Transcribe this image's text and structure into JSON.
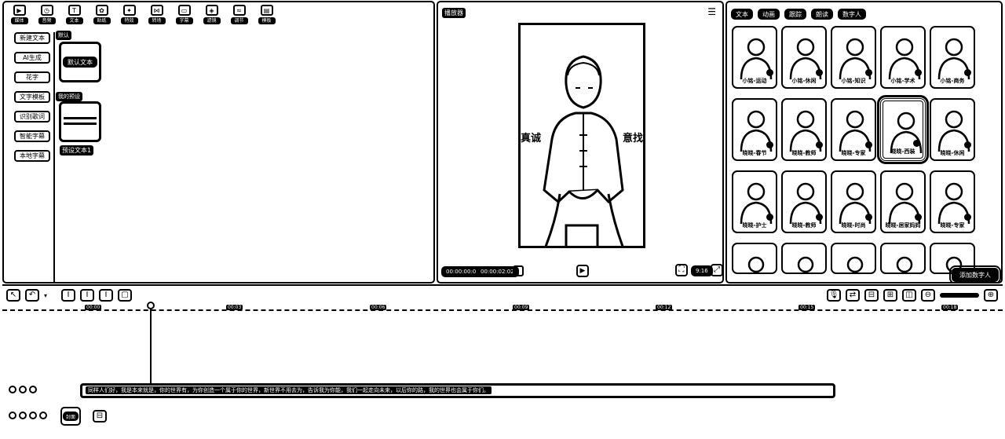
{
  "toolbar": {
    "items": [
      {
        "label": "媒体",
        "icon": "media-icon"
      },
      {
        "label": "音频",
        "icon": "audio-icon"
      },
      {
        "label": "文本",
        "icon": "text-icon"
      },
      {
        "label": "贴纸",
        "icon": "sticker-icon"
      },
      {
        "label": "特效",
        "icon": "effects-icon"
      },
      {
        "label": "转场",
        "icon": "transition-icon"
      },
      {
        "label": "字幕",
        "icon": "caption-icon"
      },
      {
        "label": "滤镜",
        "icon": "filter-icon"
      },
      {
        "label": "调节",
        "icon": "adjust-icon"
      },
      {
        "label": "模板",
        "icon": "template-icon"
      }
    ]
  },
  "text_nav": {
    "items": [
      "新建文本",
      "AI生成",
      "花字",
      "文字模板",
      "识别歌词",
      "智能字幕",
      "本地字幕"
    ]
  },
  "text_library": {
    "default_section": "默认",
    "default_card": "默认文本",
    "preset_section": "我的预设",
    "preset_card": "预设文本1"
  },
  "player": {
    "title": "播放器",
    "subtitle_left": "真诚",
    "subtitle_right": "意找",
    "current_time": "00:00:00:00",
    "total_time": "00:00:02:02",
    "ratio": "9:16"
  },
  "digital_human": {
    "tabs": [
      "文本",
      "动画",
      "跟踪",
      "朗读",
      "数字人"
    ],
    "avatars": [
      "小铭-运动",
      "小铭-休闲",
      "小铭-知识",
      "小铭-学术",
      "小铭-商务",
      "晓晓-春节",
      "晓晓-教师",
      "晓晓-专家",
      "晓晓-西装",
      "晓晓-休闲",
      "晓晓-护士",
      "晓晓-教师",
      "晓晓-时尚",
      "晓晓-居家妈妈",
      "晓晓-专家"
    ],
    "add_button": "添加数字人"
  },
  "timeline": {
    "ticks": [
      "00:00",
      "00:03",
      "00:06",
      "00:09",
      "00:12",
      "00:15",
      "00:18"
    ],
    "text_clip": "同样人们好，我是本来就是，你的世界有，为你创造一个属于你的世界，新世界不用去为，告诉我为你能，我们一起走向未来，以后你的路，我的世界也会属于你们。",
    "cover_label": "封面"
  }
}
